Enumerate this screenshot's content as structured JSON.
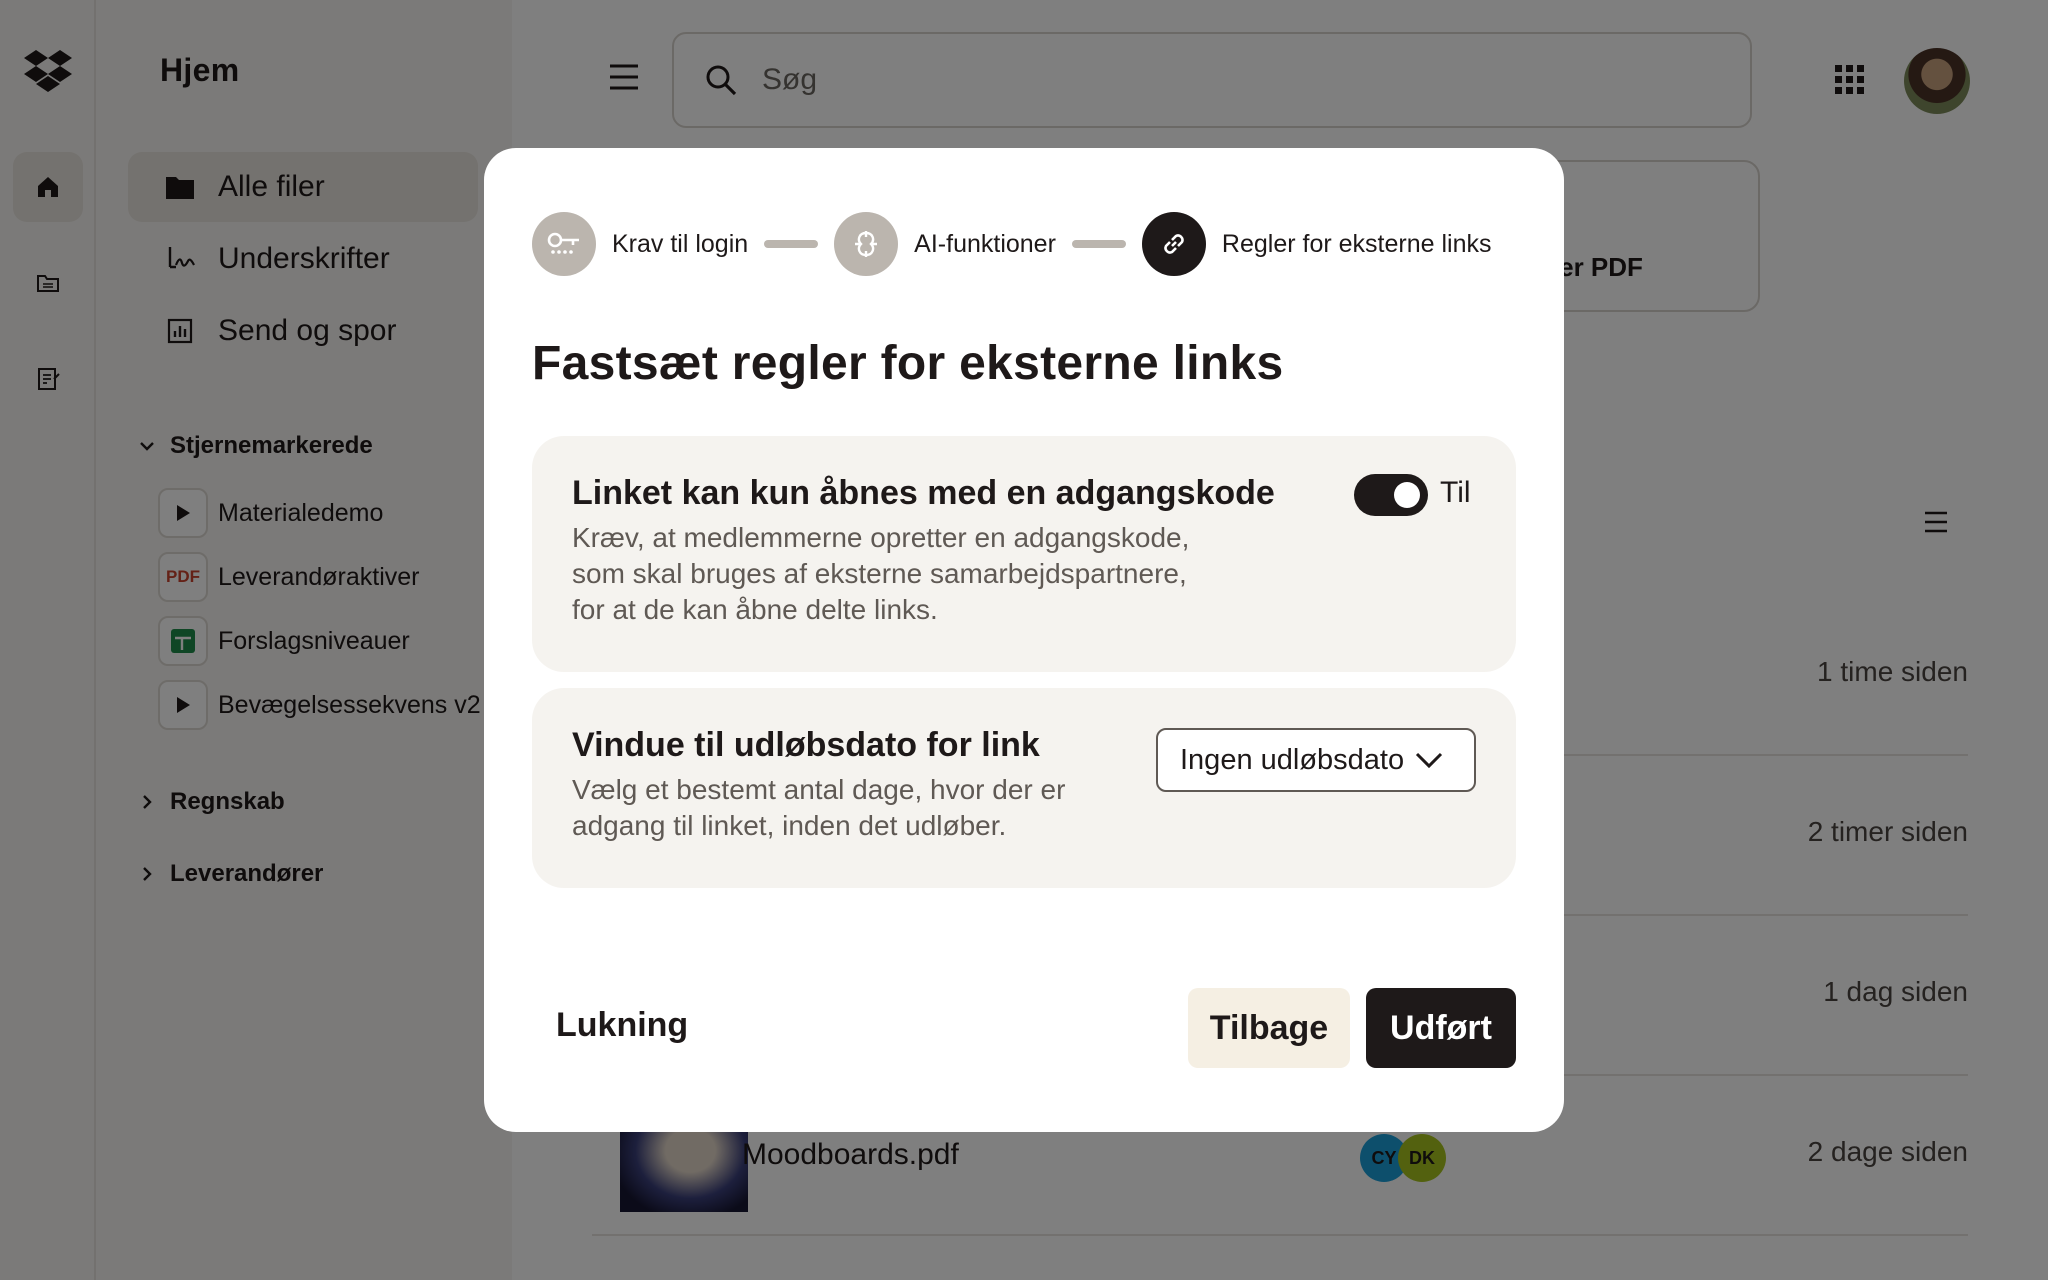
{
  "sidebar": {
    "title": "Hjem",
    "nav": [
      {
        "label": "Alle filer",
        "icon": "folder-icon"
      },
      {
        "label": "Underskrifter",
        "icon": "signature-icon"
      },
      {
        "label": "Send og spor",
        "icon": "chart-icon"
      }
    ],
    "starred_heading": "Stjernemarkerede",
    "starred": [
      {
        "label": "Materialedemo",
        "icon": "play-icon"
      },
      {
        "label": "Leverandøraktiver",
        "icon": "pdf-icon",
        "badge": "PDF"
      },
      {
        "label": "Forslagsniveauer",
        "icon": "sheet-icon"
      },
      {
        "label": "Bevægelsessekvens v2",
        "icon": "play-icon"
      }
    ],
    "sections": [
      "Regnskab",
      "Leverandører"
    ]
  },
  "header": {
    "search_placeholder": "Søg"
  },
  "main": {
    "card_label": "iger PDF",
    "rows": [
      {
        "time": "1 time siden"
      },
      {
        "time": "2 timer siden"
      },
      {
        "time": "1 dag siden"
      },
      {
        "name": "Moodboards.pdf",
        "time": "2 dage siden",
        "avatars": [
          "CY",
          "DK"
        ]
      }
    ]
  },
  "modal": {
    "steps": [
      {
        "label": "Krav til login",
        "icon": "key-icon"
      },
      {
        "label": "AI-funktioner",
        "icon": "ai-icon"
      },
      {
        "label": "Regler for eksterne links",
        "icon": "link-icon"
      }
    ],
    "title": "Fastsæt regler for eksterne links",
    "password_panel": {
      "title": "Linket kan kun åbnes med en adgangskode",
      "desc_lines": [
        "Kræv, at medlemmerne opretter en adgangskode,",
        "som skal bruges af eksterne samarbejdspartnere,",
        "for at de kan åbne delte links."
      ],
      "toggle_label": "Til",
      "toggle_on": true
    },
    "expiry_panel": {
      "title": "Vindue til udløbsdato for link",
      "desc_lines": [
        "Vælg et bestemt antal dage, hvor der er",
        "adgang til linket, inden det udløber."
      ],
      "select_value": "Ingen udløbsdato"
    },
    "close_label": "Lukning",
    "back_label": "Tilbage",
    "done_label": "Udført"
  },
  "colors": {
    "primary": "#1e1919",
    "panel_bg": "#f5f3ef",
    "step_inactive": "#bbb5ae",
    "back_bg": "#f5efe3"
  }
}
